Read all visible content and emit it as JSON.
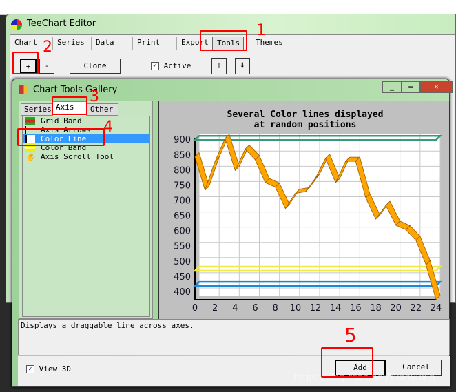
{
  "editor": {
    "title": "TeeChart Editor",
    "tabs": [
      "Chart",
      "Series",
      "Data",
      "Print",
      "Export",
      "Tools",
      "Themes"
    ],
    "active_tab": "Tools",
    "toolbar": {
      "add": "+",
      "remove": "-",
      "clone": "Clone",
      "active_label": "Active",
      "active_checked": true,
      "up_icon": "arrow-up-icon",
      "down_icon": "arrow-down-icon"
    }
  },
  "gallery": {
    "title": "Chart Tools Gallery",
    "tabs": [
      "Series",
      "Axis",
      "Other"
    ],
    "active_tab": "Axis",
    "items": [
      {
        "label": "Grid Band",
        "icon": "grid-band-icon"
      },
      {
        "label": "Axis Arrows",
        "icon": "axis-arrows-icon"
      },
      {
        "label": "Color Line",
        "icon": "color-line-icon",
        "selected": true
      },
      {
        "label": "Color Band",
        "icon": "color-band-icon"
      },
      {
        "label": "Axis Scroll Tool",
        "icon": "hand-icon"
      }
    ],
    "description": "Displays a draggable line across axes.",
    "view3d_label": "View 3D",
    "view3d_checked": true,
    "add_label": "Add",
    "cancel_label": "Cancel"
  },
  "annotations": [
    "1",
    "2",
    "3",
    "4",
    "5"
  ],
  "watermark": "https://blog.csdn.net/Yuanyuxin",
  "chart_data": {
    "type": "line",
    "title": "Several Color lines displayed\nat random positions",
    "title_lines": [
      "Several Color lines displayed",
      "at random positions"
    ],
    "x": [
      0,
      1,
      2,
      3,
      4,
      5,
      6,
      7,
      8,
      9,
      10,
      11,
      12,
      13,
      14,
      15,
      16,
      17,
      18,
      19,
      20,
      21,
      22,
      23,
      24
    ],
    "series": [
      {
        "values": [
          845,
          735,
          830,
          905,
          800,
          870,
          835,
          760,
          745,
          675,
          725,
          730,
          775,
          840,
          760,
          830,
          830,
          710,
          640,
          685,
          620,
          605,
          570,
          490,
          375
        ],
        "color": "#ffa500"
      }
    ],
    "color_lines": [
      {
        "value": 900,
        "color": "#3a9a78"
      },
      {
        "value": 470,
        "color": "#f0e840"
      },
      {
        "value": 420,
        "color": "#1e88d8"
      }
    ],
    "xticks": [
      0,
      2,
      4,
      6,
      8,
      10,
      12,
      14,
      16,
      18,
      20,
      22,
      24
    ],
    "yticks": [
      400,
      450,
      500,
      550,
      600,
      650,
      700,
      750,
      800,
      850,
      900
    ],
    "xlim": [
      0,
      24
    ],
    "ylim": [
      375,
      905
    ],
    "grid": true,
    "view3d": true
  }
}
